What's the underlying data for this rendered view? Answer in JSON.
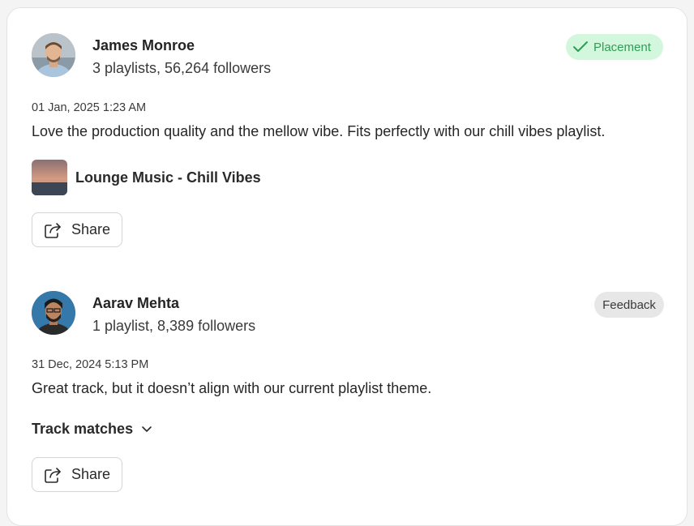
{
  "posts": [
    {
      "curator_name": "James Monroe",
      "curator_meta": "3 playlists, 56,264 followers",
      "badge_label": "Placement",
      "date": "01 Jan, 2025 1:23 AM",
      "comment": "Love the production quality and the mellow vibe. Fits perfectly with our chill vibes playlist.",
      "playlist_title": "Lounge Music - Chill Vibes",
      "share_label": "Share"
    },
    {
      "curator_name": "Aarav Mehta",
      "curator_meta": "1 playlist, 8,389 followers",
      "badge_label": "Feedback",
      "date": "31 Dec, 2024 5:13 PM",
      "comment": "Great track, but it doesn’t align with our current playlist theme.",
      "track_matches_label": "Track matches",
      "share_label": "Share"
    }
  ],
  "colors": {
    "placement_bg": "#d3f7dc",
    "placement_text": "#2e9e57",
    "feedback_bg": "#e7e7e7"
  },
  "icons": {
    "check": "check-icon",
    "share": "share-icon",
    "chevron": "chevron-down-icon"
  }
}
